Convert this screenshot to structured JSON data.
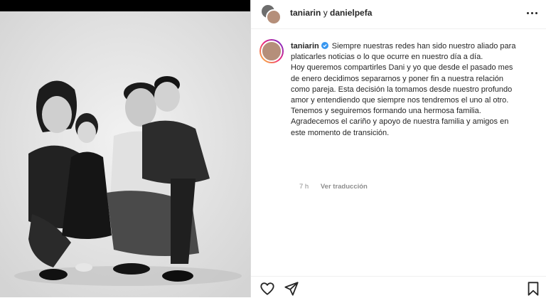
{
  "header": {
    "user1": "taniarin",
    "separator": "y",
    "user2": "danielpefa"
  },
  "caption": {
    "username": "taniarin",
    "verified": true,
    "lines": [
      "Siempre nuestras redes han sido nuestro aliado para",
      "platicarles noticias o lo que ocurre en nuestro día a día.",
      "Hoy queremos compartirles Dani y yo que desde el pasado mes",
      "de enero decidimos separarnos y poner fin a nuestra relación",
      "como pareja. Esta decisión la tomamos desde nuestro profundo",
      "amor y entendiendo que siempre nos tendremos el uno al otro.",
      "Tenemos y seguiremos formando una hermosa familia.",
      "Agradecemos el cariño y apoyo de nuestra familia y amigos en",
      "este momento de transición."
    ],
    "time": "7 h",
    "translate_label": "Ver traducción"
  },
  "icons": {
    "more": "more-options-icon",
    "like": "heart-icon",
    "share": "paper-plane-icon",
    "save": "bookmark-icon",
    "verified": "verified-badge-icon"
  },
  "colors": {
    "verified": "#3897f0",
    "text": "#262626",
    "muted": "#8e8e8e"
  }
}
